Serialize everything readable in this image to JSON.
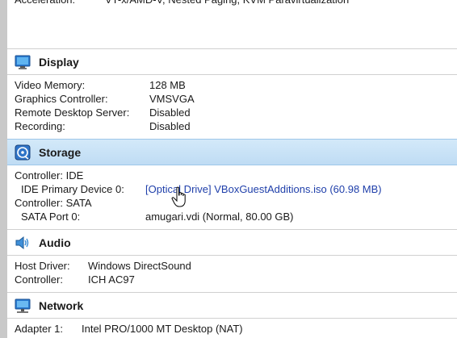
{
  "partial_top": {
    "label": "Acceleration:",
    "value": "VT-x/AMD-V, Nested Paging, KVM Paravirtualization"
  },
  "display": {
    "title": "Display",
    "icon": "monitor-icon",
    "rows": [
      {
        "label": "Video Memory:",
        "value": "128 MB"
      },
      {
        "label": "Graphics Controller:",
        "value": "VMSVGA"
      },
      {
        "label": "Remote Desktop Server:",
        "value": "Disabled"
      },
      {
        "label": "Recording:",
        "value": "Disabled"
      }
    ]
  },
  "storage": {
    "title": "Storage",
    "icon": "storage-icon",
    "controller_ide": "Controller: IDE",
    "ide_primary_label": "IDE Primary Device 0:",
    "ide_primary_value": "[Optical Drive] VBoxGuestAdditions.iso (60.98 MB)",
    "controller_sata": "Controller: SATA",
    "sata_port_label": "SATA Port 0:",
    "sata_port_value": "amugari.vdi (Normal, 80.00 GB)"
  },
  "audio": {
    "title": "Audio",
    "icon": "speaker-icon",
    "rows": [
      {
        "label": "Host Driver:",
        "value": "Windows DirectSound"
      },
      {
        "label": "Controller:",
        "value": "ICH AC97"
      }
    ]
  },
  "network": {
    "title": "Network",
    "icon": "network-icon",
    "rows": [
      {
        "label": "Adapter 1:",
        "value": "Intel PRO/1000 MT Desktop (NAT)"
      }
    ]
  },
  "colors": {
    "selected_header": "#c6e0f6",
    "link": "#1f3faa",
    "left_edge": "#c9c9c9"
  }
}
